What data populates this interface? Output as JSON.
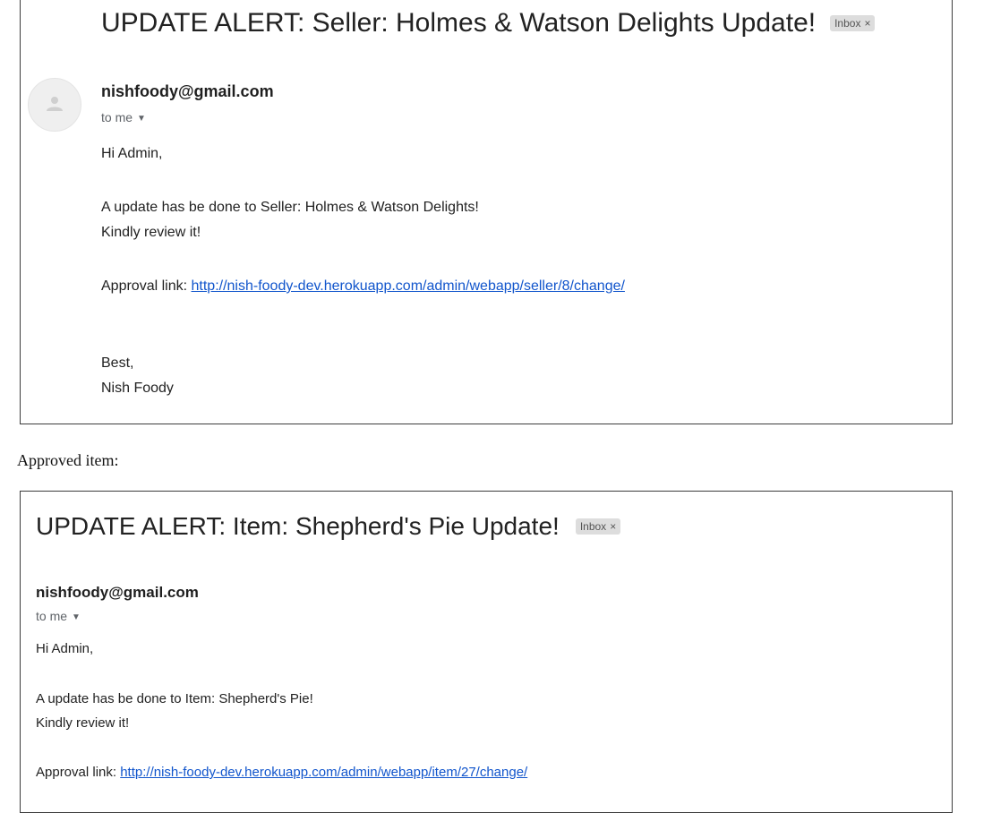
{
  "email1": {
    "subject": "UPDATE ALERT: Seller: Holmes & Watson Delights Update!",
    "label": "Inbox",
    "label_close": "×",
    "sender": "nishfoody@gmail.com",
    "recipient": "to me",
    "greeting": "Hi Admin,",
    "line1": "A update has be done to Seller: Holmes & Watson Delights!",
    "line2": "Kindly review it!",
    "link_label": "Approval link: ",
    "link_url": "http://nish-foody-dev.herokuapp.com/admin/webapp/seller/8/change/",
    "signoff": "Best,",
    "signature": "Nish Foody"
  },
  "caption": "Approved item:",
  "email2": {
    "subject": "UPDATE ALERT: Item: Shepherd's Pie Update!",
    "label": "Inbox",
    "label_close": "×",
    "sender": "nishfoody@gmail.com",
    "recipient": "to me",
    "greeting": "Hi Admin,",
    "line1": "A update has be done to Item: Shepherd's Pie!",
    "line2": "Kindly review it!",
    "link_label": "Approval link: ",
    "link_url": "http://nish-foody-dev.herokuapp.com/admin/webapp/item/27/change/"
  },
  "icons": {
    "avatar": "person-icon",
    "caret": "caret-down-icon",
    "label_close": "close-icon"
  },
  "colors": {
    "link": "#1155cc",
    "badge_bg": "#dddddd",
    "frame": "#3c3c3c"
  }
}
